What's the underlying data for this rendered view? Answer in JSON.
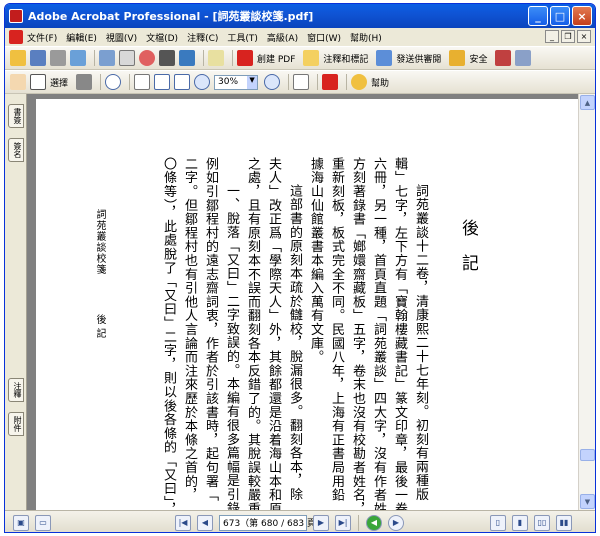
{
  "window": {
    "title": "Adobe Acrobat Professional - [詞苑叢談校箋.pdf]"
  },
  "menu": [
    "文件(F)",
    "編輯(E)",
    "視圖(V)",
    "文檔(D)",
    "注釋(C)",
    "工具(T)",
    "高級(A)",
    "窗口(W)",
    "幫助(H)"
  ],
  "toolbar1": {
    "create_pdf": "創建 PDF",
    "comment_markup": "注釋和標記",
    "send_review": "發送供審閱",
    "security": "安全"
  },
  "toolbar2": {
    "select": "選擇",
    "zoom": "30%",
    "help": "幫助"
  },
  "sidetabs": [
    "書簽",
    "簽名",
    "注釋",
    "附件"
  ],
  "status": {
    "page_field": "673（第 680 / 683 頁）"
  },
  "doc": {
    "heading": "後記",
    "columns": [
      "詞苑叢談十二卷，清康熙二十七年刻。初刻有兩種版",
      "輯」七字，左下方有「寶翰樓藏書記」篆文印章，最後一卷末",
      "六冊，另一種，首頁直題「詞苑叢談」四大字，沒有作者姓氏",
      "方刻著錄書「嫏嬛齋藏板」五字，卷末也沒有校勘者姓名，",
      "重新刻板，板式完全不同。民國八年，上海有正書局用鉛",
      "據海山仙館叢書本編入萬有文庫。",
      "這部書的原刻本疏於讎校，脫漏很多。翻刻各本，除",
      "夫人」改正爲「學際天人」外，其餘都還是沿着海山本和原刻",
      "之處，且有原刻本不誤而翻刻各本反錯了的。其脫誤較嚴重",
      "一、脫落「又曰」二字致誤的。本編有很多篇幅是引錄他",
      "例如引鄒程村的遠志齋詞衷，作者於引該書時，起句署「",
      "二字。但鄒程村也有引他人言論而注來歷於本條之首的，",
      "〇條等），此處脫了「又曰」二字，則以後各條的「又曰」，便都"
    ],
    "footer_title": "詞苑叢談校箋",
    "footer_section": "後記"
  }
}
